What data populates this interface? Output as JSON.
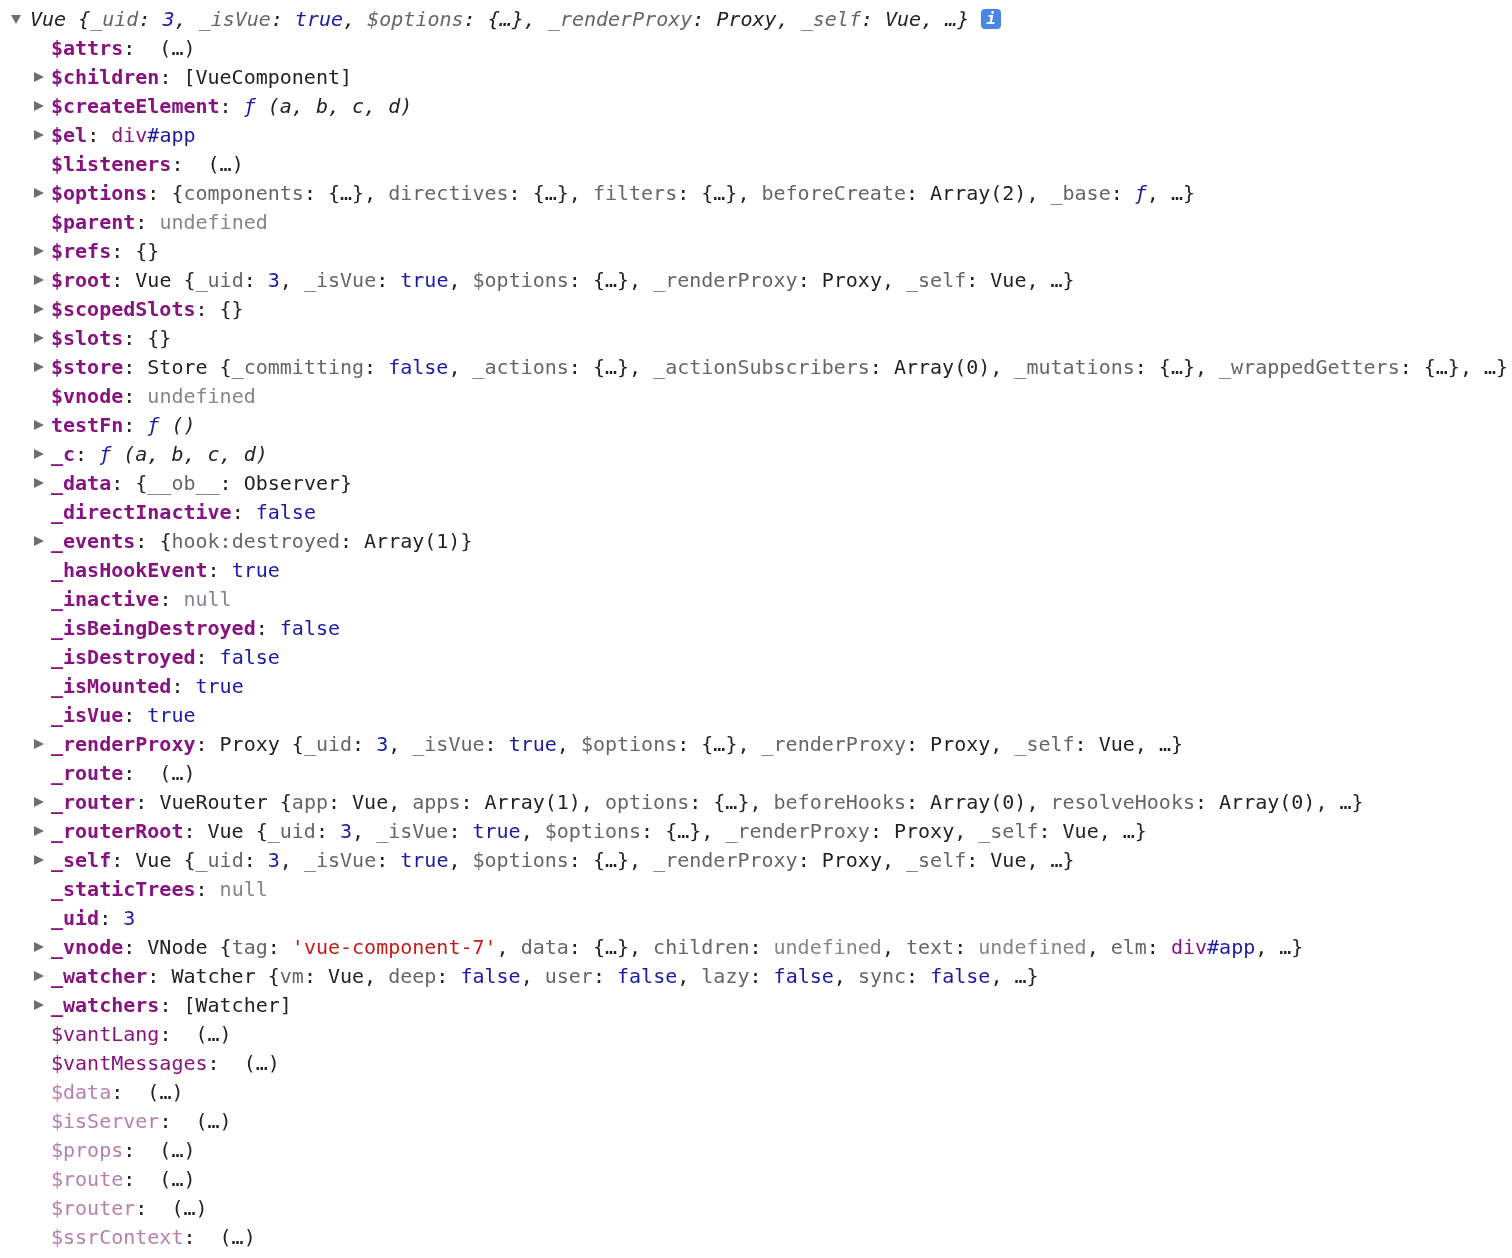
{
  "header": {
    "expanded": true,
    "summary": [
      {
        "kind": "plain",
        "text": "Vue {"
      },
      {
        "kind": "prop",
        "text": "_uid"
      },
      {
        "kind": "plain",
        "text": ": "
      },
      {
        "kind": "kw",
        "text": "3"
      },
      {
        "kind": "plain",
        "text": ", "
      },
      {
        "kind": "prop",
        "text": "_isVue"
      },
      {
        "kind": "plain",
        "text": ": "
      },
      {
        "kind": "kw",
        "text": "true"
      },
      {
        "kind": "plain",
        "text": ", "
      },
      {
        "kind": "prop",
        "text": "$options"
      },
      {
        "kind": "plain",
        "text": ": {…}, "
      },
      {
        "kind": "prop",
        "text": "_renderProxy"
      },
      {
        "kind": "plain",
        "text": ": Proxy, "
      },
      {
        "kind": "prop",
        "text": "_self"
      },
      {
        "kind": "plain",
        "text": ": Vue, …}"
      }
    ],
    "info_badge": "i"
  },
  "rows": [
    {
      "key": {
        "kind": "bold",
        "text": "$attrs"
      },
      "kind": "leaf",
      "expanded": false,
      "value": [
        {
          "kind": "plain",
          "text": ":  (…)"
        }
      ]
    },
    {
      "key": {
        "kind": "bold",
        "text": "$children"
      },
      "kind": "object",
      "expanded": false,
      "value": [
        {
          "kind": "plain",
          "text": ": [VueComponent]"
        }
      ]
    },
    {
      "key": {
        "kind": "bold",
        "text": "$createElement"
      },
      "kind": "object",
      "expanded": false,
      "value": [
        {
          "kind": "plain",
          "text": ": "
        },
        {
          "kind": "fn",
          "text": "ƒ"
        },
        {
          "kind": "args",
          "text": " (a, b, c, d)"
        }
      ]
    },
    {
      "key": {
        "kind": "bold",
        "text": "$el"
      },
      "kind": "object",
      "expanded": false,
      "value": [
        {
          "kind": "plain",
          "text": ": "
        },
        {
          "kind": "tag",
          "text": "div"
        },
        {
          "kind": "kw",
          "text": "#app"
        }
      ]
    },
    {
      "key": {
        "kind": "bold",
        "text": "$listeners"
      },
      "kind": "leaf",
      "expanded": false,
      "value": [
        {
          "kind": "plain",
          "text": ":  (…)"
        }
      ]
    },
    {
      "key": {
        "kind": "bold",
        "text": "$options"
      },
      "kind": "object",
      "expanded": false,
      "value": [
        {
          "kind": "plain",
          "text": ": {"
        },
        {
          "kind": "prop",
          "text": "components"
        },
        {
          "kind": "plain",
          "text": ": {…}, "
        },
        {
          "kind": "prop",
          "text": "directives"
        },
        {
          "kind": "plain",
          "text": ": {…}, "
        },
        {
          "kind": "prop",
          "text": "filters"
        },
        {
          "kind": "plain",
          "text": ": {…}, "
        },
        {
          "kind": "prop",
          "text": "beforeCreate"
        },
        {
          "kind": "plain",
          "text": ": Array(2), "
        },
        {
          "kind": "prop",
          "text": "_base"
        },
        {
          "kind": "plain",
          "text": ": "
        },
        {
          "kind": "fn",
          "text": "ƒ"
        },
        {
          "kind": "plain",
          "text": ", …}"
        }
      ]
    },
    {
      "key": {
        "kind": "bold",
        "text": "$parent"
      },
      "kind": "leaf",
      "expanded": false,
      "value": [
        {
          "kind": "plain",
          "text": ": "
        },
        {
          "kind": "dim",
          "text": "undefined"
        }
      ]
    },
    {
      "key": {
        "kind": "bold",
        "text": "$refs"
      },
      "kind": "object",
      "expanded": false,
      "value": [
        {
          "kind": "plain",
          "text": ": {}"
        }
      ]
    },
    {
      "key": {
        "kind": "bold",
        "text": "$root"
      },
      "kind": "object",
      "expanded": false,
      "value": [
        {
          "kind": "plain",
          "text": ": Vue {"
        },
        {
          "kind": "prop",
          "text": "_uid"
        },
        {
          "kind": "plain",
          "text": ": "
        },
        {
          "kind": "kw",
          "text": "3"
        },
        {
          "kind": "plain",
          "text": ", "
        },
        {
          "kind": "prop",
          "text": "_isVue"
        },
        {
          "kind": "plain",
          "text": ": "
        },
        {
          "kind": "kw",
          "text": "true"
        },
        {
          "kind": "plain",
          "text": ", "
        },
        {
          "kind": "prop",
          "text": "$options"
        },
        {
          "kind": "plain",
          "text": ": {…}, "
        },
        {
          "kind": "prop",
          "text": "_renderProxy"
        },
        {
          "kind": "plain",
          "text": ": Proxy, "
        },
        {
          "kind": "prop",
          "text": "_self"
        },
        {
          "kind": "plain",
          "text": ": Vue, …}"
        }
      ]
    },
    {
      "key": {
        "kind": "bold",
        "text": "$scopedSlots"
      },
      "kind": "object",
      "expanded": false,
      "value": [
        {
          "kind": "plain",
          "text": ": {}"
        }
      ]
    },
    {
      "key": {
        "kind": "bold",
        "text": "$slots"
      },
      "kind": "object",
      "expanded": false,
      "value": [
        {
          "kind": "plain",
          "text": ": {}"
        }
      ]
    },
    {
      "key": {
        "kind": "bold",
        "text": "$store"
      },
      "kind": "object",
      "expanded": false,
      "value": [
        {
          "kind": "plain",
          "text": ": Store {"
        },
        {
          "kind": "prop",
          "text": "_committing"
        },
        {
          "kind": "plain",
          "text": ": "
        },
        {
          "kind": "kw",
          "text": "false"
        },
        {
          "kind": "plain",
          "text": ", "
        },
        {
          "kind": "prop",
          "text": "_actions"
        },
        {
          "kind": "plain",
          "text": ": {…}, "
        },
        {
          "kind": "prop",
          "text": "_actionSubscribers"
        },
        {
          "kind": "plain",
          "text": ": Array(0), "
        },
        {
          "kind": "prop",
          "text": "_mutations"
        },
        {
          "kind": "plain",
          "text": ": {…}, "
        },
        {
          "kind": "prop",
          "text": "_wrappedGetters"
        },
        {
          "kind": "plain",
          "text": ": {…}, …}"
        }
      ]
    },
    {
      "key": {
        "kind": "bold",
        "text": "$vnode"
      },
      "kind": "leaf",
      "expanded": false,
      "value": [
        {
          "kind": "plain",
          "text": ": "
        },
        {
          "kind": "dim",
          "text": "undefined"
        }
      ]
    },
    {
      "key": {
        "kind": "bold",
        "text": "testFn"
      },
      "kind": "object",
      "expanded": false,
      "value": [
        {
          "kind": "plain",
          "text": ": "
        },
        {
          "kind": "fn",
          "text": "ƒ"
        },
        {
          "kind": "args",
          "text": " ()"
        }
      ]
    },
    {
      "key": {
        "kind": "bold",
        "text": "_c"
      },
      "kind": "object",
      "expanded": false,
      "value": [
        {
          "kind": "plain",
          "text": ": "
        },
        {
          "kind": "fn",
          "text": "ƒ"
        },
        {
          "kind": "args",
          "text": " (a, b, c, d)"
        }
      ]
    },
    {
      "key": {
        "kind": "bold",
        "text": "_data"
      },
      "kind": "object",
      "expanded": false,
      "value": [
        {
          "kind": "plain",
          "text": ": {"
        },
        {
          "kind": "prop",
          "text": "__ob__"
        },
        {
          "kind": "plain",
          "text": ": Observer}"
        }
      ]
    },
    {
      "key": {
        "kind": "bold",
        "text": "_directInactive"
      },
      "kind": "leaf",
      "expanded": false,
      "value": [
        {
          "kind": "plain",
          "text": ": "
        },
        {
          "kind": "kw",
          "text": "false"
        }
      ]
    },
    {
      "key": {
        "kind": "bold",
        "text": "_events"
      },
      "kind": "object",
      "expanded": false,
      "value": [
        {
          "kind": "plain",
          "text": ": {"
        },
        {
          "kind": "prop",
          "text": "hook:destroyed"
        },
        {
          "kind": "plain",
          "text": ": Array(1)}"
        }
      ]
    },
    {
      "key": {
        "kind": "bold",
        "text": "_hasHookEvent"
      },
      "kind": "leaf",
      "expanded": false,
      "value": [
        {
          "kind": "plain",
          "text": ": "
        },
        {
          "kind": "kw",
          "text": "true"
        }
      ]
    },
    {
      "key": {
        "kind": "bold",
        "text": "_inactive"
      },
      "kind": "leaf",
      "expanded": false,
      "value": [
        {
          "kind": "plain",
          "text": ": "
        },
        {
          "kind": "dim",
          "text": "null"
        }
      ]
    },
    {
      "key": {
        "kind": "bold",
        "text": "_isBeingDestroyed"
      },
      "kind": "leaf",
      "expanded": false,
      "value": [
        {
          "kind": "plain",
          "text": ": "
        },
        {
          "kind": "kw",
          "text": "false"
        }
      ]
    },
    {
      "key": {
        "kind": "bold",
        "text": "_isDestroyed"
      },
      "kind": "leaf",
      "expanded": false,
      "value": [
        {
          "kind": "plain",
          "text": ": "
        },
        {
          "kind": "kw",
          "text": "false"
        }
      ]
    },
    {
      "key": {
        "kind": "bold",
        "text": "_isMounted"
      },
      "kind": "leaf",
      "expanded": false,
      "value": [
        {
          "kind": "plain",
          "text": ": "
        },
        {
          "kind": "kw",
          "text": "true"
        }
      ]
    },
    {
      "key": {
        "kind": "bold",
        "text": "_isVue"
      },
      "kind": "leaf",
      "expanded": false,
      "value": [
        {
          "kind": "plain",
          "text": ": "
        },
        {
          "kind": "kw",
          "text": "true"
        }
      ]
    },
    {
      "key": {
        "kind": "bold",
        "text": "_renderProxy"
      },
      "kind": "object",
      "expanded": false,
      "value": [
        {
          "kind": "plain",
          "text": ": Proxy {"
        },
        {
          "kind": "prop",
          "text": "_uid"
        },
        {
          "kind": "plain",
          "text": ": "
        },
        {
          "kind": "kw",
          "text": "3"
        },
        {
          "kind": "plain",
          "text": ", "
        },
        {
          "kind": "prop",
          "text": "_isVue"
        },
        {
          "kind": "plain",
          "text": ": "
        },
        {
          "kind": "kw",
          "text": "true"
        },
        {
          "kind": "plain",
          "text": ", "
        },
        {
          "kind": "prop",
          "text": "$options"
        },
        {
          "kind": "plain",
          "text": ": {…}, "
        },
        {
          "kind": "prop",
          "text": "_renderProxy"
        },
        {
          "kind": "plain",
          "text": ": Proxy, "
        },
        {
          "kind": "prop",
          "text": "_self"
        },
        {
          "kind": "plain",
          "text": ": Vue, …}"
        }
      ]
    },
    {
      "key": {
        "kind": "bold",
        "text": "_route"
      },
      "kind": "leaf",
      "expanded": false,
      "value": [
        {
          "kind": "plain",
          "text": ":  (…)"
        }
      ]
    },
    {
      "key": {
        "kind": "bold",
        "text": "_router"
      },
      "kind": "object",
      "expanded": false,
      "value": [
        {
          "kind": "plain",
          "text": ": VueRouter {"
        },
        {
          "kind": "prop",
          "text": "app"
        },
        {
          "kind": "plain",
          "text": ": Vue, "
        },
        {
          "kind": "prop",
          "text": "apps"
        },
        {
          "kind": "plain",
          "text": ": Array(1), "
        },
        {
          "kind": "prop",
          "text": "options"
        },
        {
          "kind": "plain",
          "text": ": {…}, "
        },
        {
          "kind": "prop",
          "text": "beforeHooks"
        },
        {
          "kind": "plain",
          "text": ": Array(0), "
        },
        {
          "kind": "prop",
          "text": "resolveHooks"
        },
        {
          "kind": "plain",
          "text": ": Array(0), …}"
        }
      ]
    },
    {
      "key": {
        "kind": "bold",
        "text": "_routerRoot"
      },
      "kind": "object",
      "expanded": false,
      "value": [
        {
          "kind": "plain",
          "text": ": Vue {"
        },
        {
          "kind": "prop",
          "text": "_uid"
        },
        {
          "kind": "plain",
          "text": ": "
        },
        {
          "kind": "kw",
          "text": "3"
        },
        {
          "kind": "plain",
          "text": ", "
        },
        {
          "kind": "prop",
          "text": "_isVue"
        },
        {
          "kind": "plain",
          "text": ": "
        },
        {
          "kind": "kw",
          "text": "true"
        },
        {
          "kind": "plain",
          "text": ", "
        },
        {
          "kind": "prop",
          "text": "$options"
        },
        {
          "kind": "plain",
          "text": ": {…}, "
        },
        {
          "kind": "prop",
          "text": "_renderProxy"
        },
        {
          "kind": "plain",
          "text": ": Proxy, "
        },
        {
          "kind": "prop",
          "text": "_self"
        },
        {
          "kind": "plain",
          "text": ": Vue, …}"
        }
      ]
    },
    {
      "key": {
        "kind": "bold",
        "text": "_self"
      },
      "kind": "object",
      "expanded": false,
      "value": [
        {
          "kind": "plain",
          "text": ": Vue {"
        },
        {
          "kind": "prop",
          "text": "_uid"
        },
        {
          "kind": "plain",
          "text": ": "
        },
        {
          "kind": "kw",
          "text": "3"
        },
        {
          "kind": "plain",
          "text": ", "
        },
        {
          "kind": "prop",
          "text": "_isVue"
        },
        {
          "kind": "plain",
          "text": ": "
        },
        {
          "kind": "kw",
          "text": "true"
        },
        {
          "kind": "plain",
          "text": ", "
        },
        {
          "kind": "prop",
          "text": "$options"
        },
        {
          "kind": "plain",
          "text": ": {…}, "
        },
        {
          "kind": "prop",
          "text": "_renderProxy"
        },
        {
          "kind": "plain",
          "text": ": Proxy, "
        },
        {
          "kind": "prop",
          "text": "_self"
        },
        {
          "kind": "plain",
          "text": ": Vue, …}"
        }
      ]
    },
    {
      "key": {
        "kind": "bold",
        "text": "_staticTrees"
      },
      "kind": "leaf",
      "expanded": false,
      "value": [
        {
          "kind": "plain",
          "text": ": "
        },
        {
          "kind": "dim",
          "text": "null"
        }
      ]
    },
    {
      "key": {
        "kind": "bold",
        "text": "_uid"
      },
      "kind": "leaf",
      "expanded": false,
      "value": [
        {
          "kind": "plain",
          "text": ": "
        },
        {
          "kind": "kw",
          "text": "3"
        }
      ]
    },
    {
      "key": {
        "kind": "bold",
        "text": "_vnode"
      },
      "kind": "object",
      "expanded": false,
      "value": [
        {
          "kind": "plain",
          "text": ": VNode {"
        },
        {
          "kind": "prop",
          "text": "tag"
        },
        {
          "kind": "plain",
          "text": ": "
        },
        {
          "kind": "str",
          "text": "'vue-component-7'"
        },
        {
          "kind": "plain",
          "text": ", "
        },
        {
          "kind": "prop",
          "text": "data"
        },
        {
          "kind": "plain",
          "text": ": {…}, "
        },
        {
          "kind": "prop",
          "text": "children"
        },
        {
          "kind": "plain",
          "text": ": "
        },
        {
          "kind": "dim",
          "text": "undefined"
        },
        {
          "kind": "plain",
          "text": ", "
        },
        {
          "kind": "prop",
          "text": "text"
        },
        {
          "kind": "plain",
          "text": ": "
        },
        {
          "kind": "dim",
          "text": "undefined"
        },
        {
          "kind": "plain",
          "text": ", "
        },
        {
          "kind": "prop",
          "text": "elm"
        },
        {
          "kind": "plain",
          "text": ": "
        },
        {
          "kind": "tag",
          "text": "div"
        },
        {
          "kind": "kw",
          "text": "#app"
        },
        {
          "kind": "plain",
          "text": ", …}"
        }
      ]
    },
    {
      "key": {
        "kind": "bold",
        "text": "_watcher"
      },
      "kind": "object",
      "expanded": false,
      "value": [
        {
          "kind": "plain",
          "text": ": Watcher {"
        },
        {
          "kind": "prop",
          "text": "vm"
        },
        {
          "kind": "plain",
          "text": ": Vue, "
        },
        {
          "kind": "prop",
          "text": "deep"
        },
        {
          "kind": "plain",
          "text": ": "
        },
        {
          "kind": "kw",
          "text": "false"
        },
        {
          "kind": "plain",
          "text": ", "
        },
        {
          "kind": "prop",
          "text": "user"
        },
        {
          "kind": "plain",
          "text": ": "
        },
        {
          "kind": "kw",
          "text": "false"
        },
        {
          "kind": "plain",
          "text": ", "
        },
        {
          "kind": "prop",
          "text": "lazy"
        },
        {
          "kind": "plain",
          "text": ": "
        },
        {
          "kind": "kw",
          "text": "false"
        },
        {
          "kind": "plain",
          "text": ", "
        },
        {
          "kind": "prop",
          "text": "sync"
        },
        {
          "kind": "plain",
          "text": ": "
        },
        {
          "kind": "kw",
          "text": "false"
        },
        {
          "kind": "plain",
          "text": ", …}"
        }
      ]
    },
    {
      "key": {
        "kind": "bold",
        "text": "_watchers"
      },
      "kind": "object",
      "expanded": false,
      "value": [
        {
          "kind": "plain",
          "text": ": [Watcher]"
        }
      ]
    },
    {
      "key": {
        "kind": "normal",
        "text": "$vantLang"
      },
      "kind": "leaf",
      "expanded": false,
      "value": [
        {
          "kind": "plain",
          "text": ":  (…)"
        }
      ]
    },
    {
      "key": {
        "kind": "normal",
        "text": "$vantMessages"
      },
      "kind": "leaf",
      "expanded": false,
      "value": [
        {
          "kind": "plain",
          "text": ":  (…)"
        }
      ]
    },
    {
      "key": {
        "kind": "faded",
        "text": "$data"
      },
      "kind": "leaf",
      "expanded": false,
      "value": [
        {
          "kind": "plain",
          "text": ":  (…)"
        }
      ]
    },
    {
      "key": {
        "kind": "faded",
        "text": "$isServer"
      },
      "kind": "leaf",
      "expanded": false,
      "value": [
        {
          "kind": "plain",
          "text": ":  (…)"
        }
      ]
    },
    {
      "key": {
        "kind": "faded",
        "text": "$props"
      },
      "kind": "leaf",
      "expanded": false,
      "value": [
        {
          "kind": "plain",
          "text": ":  (…)"
        }
      ]
    },
    {
      "key": {
        "kind": "faded",
        "text": "$route"
      },
      "kind": "leaf",
      "expanded": false,
      "value": [
        {
          "kind": "plain",
          "text": ":  (…)"
        }
      ]
    },
    {
      "key": {
        "kind": "faded",
        "text": "$router"
      },
      "kind": "leaf",
      "expanded": false,
      "value": [
        {
          "kind": "plain",
          "text": ":  (…)"
        }
      ]
    },
    {
      "key": {
        "kind": "faded",
        "text": "$ssrContext"
      },
      "kind": "leaf",
      "expanded": false,
      "value": [
        {
          "kind": "plain",
          "text": ":  (…)"
        }
      ]
    }
  ]
}
